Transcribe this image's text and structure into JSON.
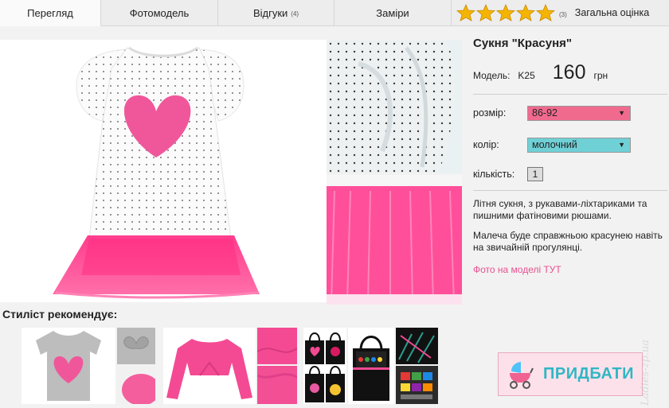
{
  "tabs": [
    {
      "label": "Перегляд",
      "active": true
    },
    {
      "label": "Фотомодель"
    },
    {
      "label": "Відгуки",
      "count": "(4)"
    },
    {
      "label": "Заміри"
    }
  ],
  "rating": {
    "stars": 5,
    "max_stars": 5,
    "count": "(3)",
    "label": "Загальна оцінка",
    "star_color": "#f4b400"
  },
  "product": {
    "title": "Сукня \"Красуня\"",
    "model_label": "Модель:",
    "model_code": "K25",
    "price": "160",
    "currency": "грн",
    "size_label": "розмір:",
    "size_value": "86-92",
    "size_color": "#f06a8e",
    "color_label": "колір:",
    "color_value": "молочний",
    "color_color": "#6fd0d6",
    "qty_label": "кількість:",
    "qty_value": "1",
    "description_1": "Літня сукня, з рукавами-ліхтариками та пишними фатіновими рюшами.",
    "description_2": "Малеча буде справжньою красунею навіть на звичайній прогулянці.",
    "photo_link": "Фото на моделі ТУТ"
  },
  "stylist": {
    "title": "Стиліст рекомендує:"
  },
  "buy": {
    "label": "ПРИДБАТИ",
    "icon": "baby-carriage-icon"
  },
  "watermark": "Ladies-zp.ua"
}
